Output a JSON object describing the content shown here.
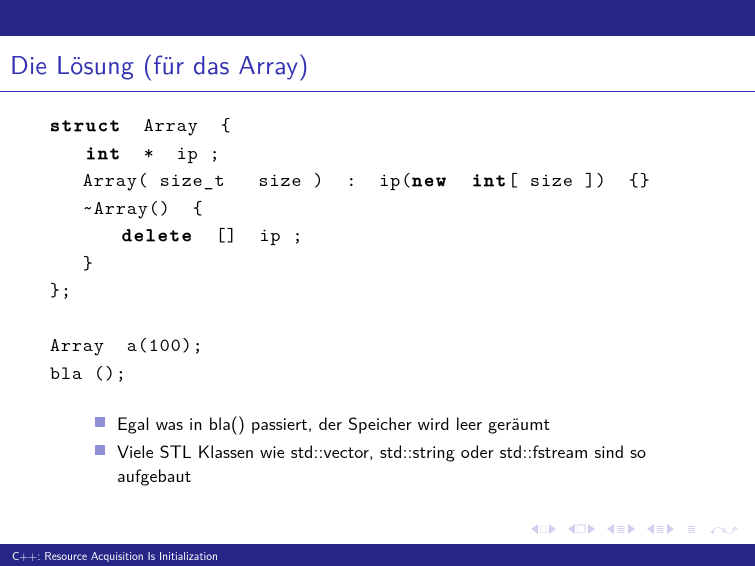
{
  "slide": {
    "title": "Die Lösung (für das Array)"
  },
  "code": {
    "l1a": "struct",
    "l1b": "  Array  {",
    "l2a": "   int",
    "l2b": "  ∗  ip ;",
    "l3a": "   Array( size_t   size )  :  ip(",
    "l3b": "new",
    "l3c": "  int",
    "l3d": "[ size ])  {}",
    "l4": "   ~Array()  {",
    "l5a": "      delete",
    "l5b": "  []  ip ;",
    "l6": "   }",
    "l7": "};",
    "l8": "",
    "l9": "Array  a(100);",
    "l10": "bla ();"
  },
  "bullets": [
    "Egal was in bla() passiert, der Speicher wird leer geräumt",
    "Viele STL Klassen wie std::vector, std::string oder std::fstream sind so aufgebaut"
  ],
  "footer": {
    "text": "C++: Resource Acquisition Is Initialization"
  }
}
